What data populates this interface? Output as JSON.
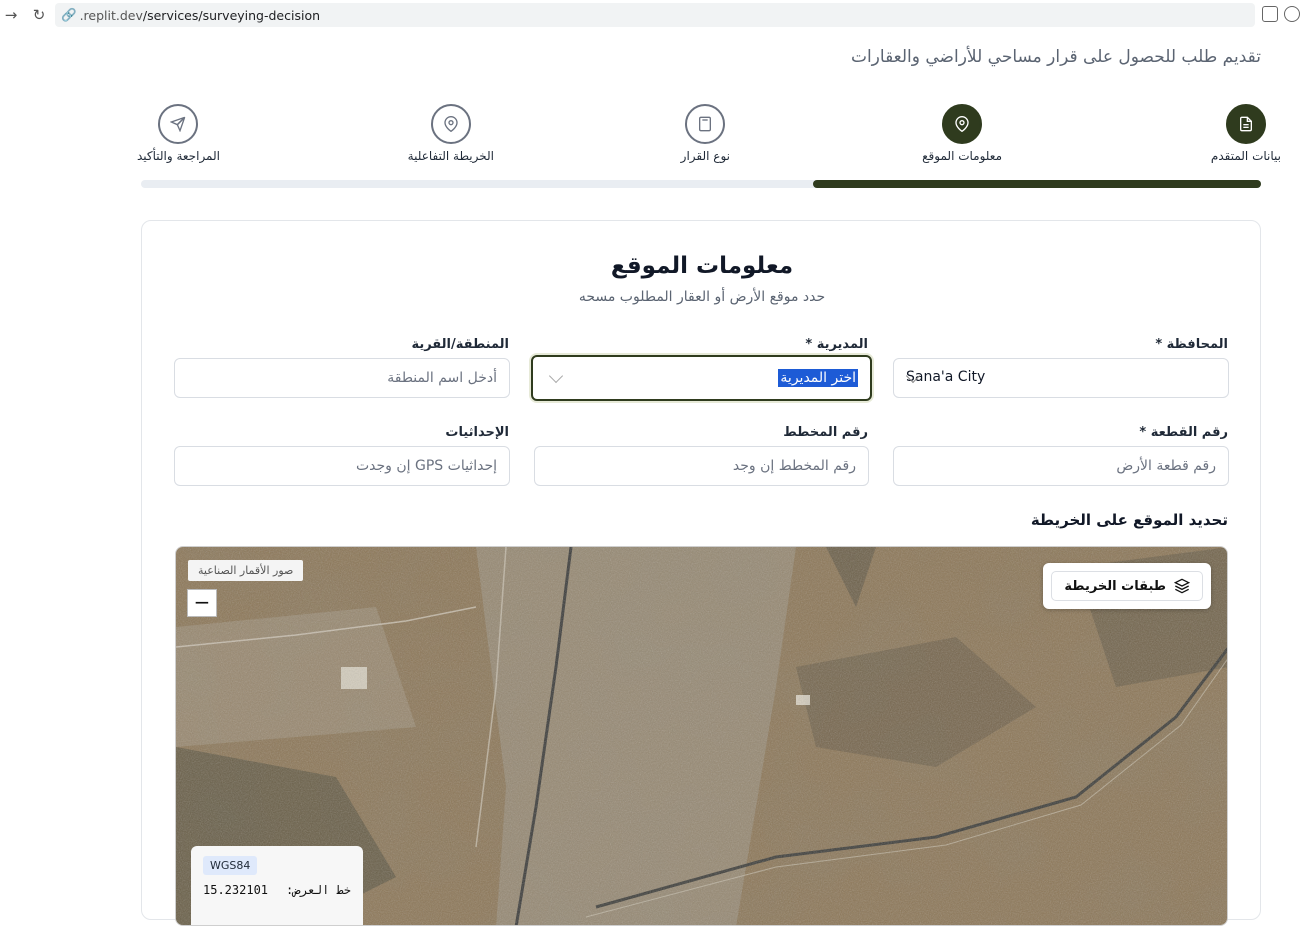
{
  "browser": {
    "url_domain": ".replit.dev",
    "url_path": "/services/surveying-decision"
  },
  "page": {
    "subtitle": "تقديم طلب للحصول على قرار مساحي للأراضي والعقارات"
  },
  "steps": [
    {
      "label": "بيانات المتقدم",
      "icon": "document-icon",
      "active": true
    },
    {
      "label": "معلومات الموقع",
      "icon": "map-pin-icon",
      "active": true
    },
    {
      "label": "نوع القرار",
      "icon": "calculator-icon",
      "active": false
    },
    {
      "label": "الخريطة التفاعلية",
      "icon": "map-pin-icon",
      "active": false
    },
    {
      "label": "المراجعة والتأكيد",
      "icon": "send-icon",
      "active": false
    }
  ],
  "progress": {
    "fraction": 0.4
  },
  "card": {
    "title": "معلومات الموقع",
    "subtitle": "حدد موقع الأرض أو العقار المطلوب مسحه"
  },
  "form": {
    "governorate": {
      "label": "المحافظة *",
      "value": "Sana'a City"
    },
    "directorate": {
      "label": "المديرية *",
      "value": "اختر المديرية"
    },
    "area": {
      "label": "المنطقة/القرية",
      "placeholder": "أدخل اسم المنطقة"
    },
    "plot": {
      "label": "رقم القطعة *",
      "placeholder": "رقم قطعة الأرض"
    },
    "plan": {
      "label": "رقم المخطط",
      "placeholder": "رقم المخطط إن وجد"
    },
    "coordinates": {
      "label": "الإحداثيات",
      "placeholder": "إحداثيات GPS إن وجدت"
    }
  },
  "map": {
    "heading": "تحديد الموقع على الخريطة",
    "satellite_chip": "صور الأقمار الصناعية",
    "zoom_out": "−",
    "layers_button": "طبقات الخريطة",
    "crs_badge": "WGS84",
    "lat_label": "خط العرض:",
    "lat_value": "15.232101"
  }
}
